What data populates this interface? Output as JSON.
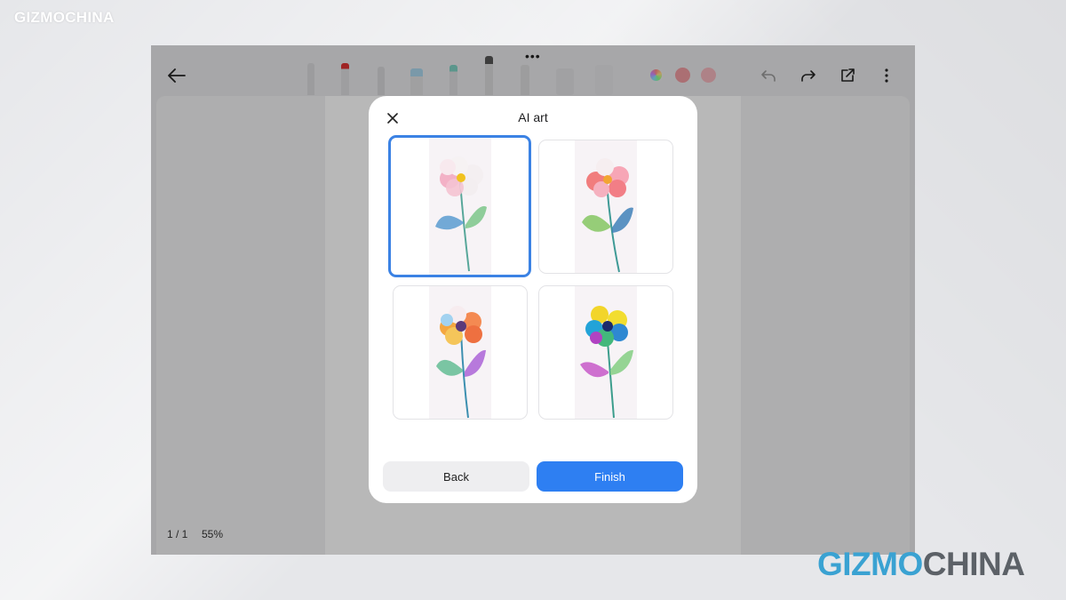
{
  "watermark": {
    "top": "GIZMOCHINA",
    "bottom_part1": "GIZMO",
    "bottom_part2": "CHINA"
  },
  "toolbar": {
    "back_icon": "arrow-left-icon",
    "tools": [
      "ballpoint-pen",
      "red-marker",
      "pencil",
      "highlighter-blue",
      "highlighter-teal",
      "fountain-pen",
      "brush",
      "lasso",
      "eraser"
    ],
    "color_swatches": [
      "#ffffff",
      "#f0a0a8",
      "#f4b8c0"
    ],
    "actions": [
      "undo-icon",
      "redo-icon",
      "share-icon",
      "more-icon"
    ]
  },
  "status": {
    "page": "1 / 1",
    "zoom": "55%"
  },
  "dialog": {
    "title": "AI art",
    "images": [
      {
        "label": "flower-white-pink",
        "selected": true
      },
      {
        "label": "flower-coral-pink",
        "selected": false
      },
      {
        "label": "flower-orange-multicolor",
        "selected": false
      },
      {
        "label": "flower-rainbow",
        "selected": false
      }
    ],
    "back_label": "Back",
    "finish_label": "Finish",
    "accent": "#2e7ff2"
  }
}
